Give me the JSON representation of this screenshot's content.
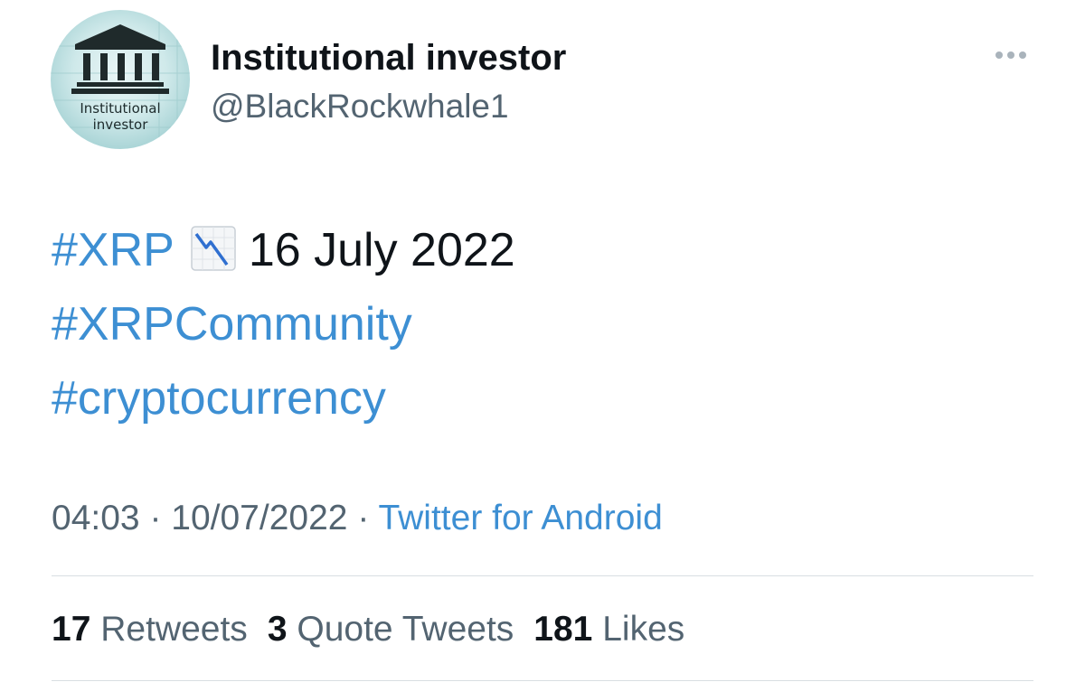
{
  "author": {
    "display_name": "Institutional investor",
    "handle": "@BlackRockwhale1",
    "avatar_line1": "Institutional",
    "avatar_line2": "investor",
    "avatar_icon": "bank-building-icon"
  },
  "tweet": {
    "line1_hashtag": "#XRP",
    "line1_emoji": "chart-decreasing-icon",
    "line1_text": "16 July 2022",
    "line2_hashtag": "#XRPCommunity",
    "line3_hashtag": "#cryptocurrency"
  },
  "meta": {
    "time": "04:03",
    "sep1": " · ",
    "date": "10/07/2022",
    "sep2": " · ",
    "source": "Twitter for Android"
  },
  "stats": {
    "retweets_count": "17",
    "retweets_label": "Retweets",
    "quotes_count": "3",
    "quotes_label": "Quote Tweets",
    "likes_count": "181",
    "likes_label": "Likes"
  },
  "colors": {
    "link": "#3d8fd3",
    "text": "#0f1419",
    "secondary": "#536471",
    "divider": "#d9dee2"
  }
}
